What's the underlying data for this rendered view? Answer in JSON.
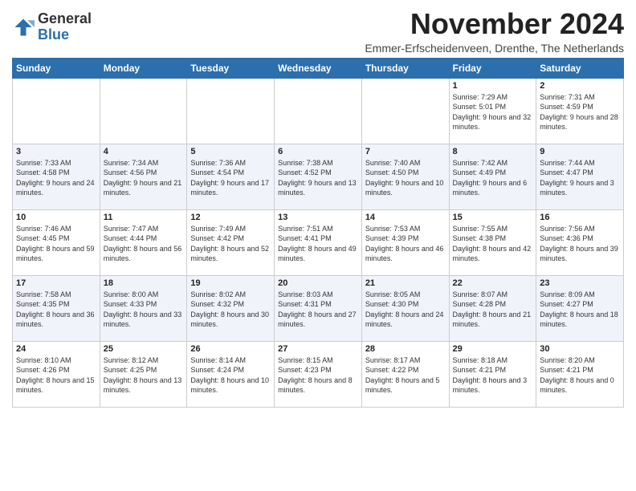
{
  "logo": {
    "general": "General",
    "blue": "Blue"
  },
  "title": "November 2024",
  "subtitle": "Emmer-Erfscheidenveen, Drenthe, The Netherlands",
  "days_of_week": [
    "Sunday",
    "Monday",
    "Tuesday",
    "Wednesday",
    "Thursday",
    "Friday",
    "Saturday"
  ],
  "weeks": [
    [
      {
        "day": "",
        "sunrise": "",
        "sunset": "",
        "daylight": ""
      },
      {
        "day": "",
        "sunrise": "",
        "sunset": "",
        "daylight": ""
      },
      {
        "day": "",
        "sunrise": "",
        "sunset": "",
        "daylight": ""
      },
      {
        "day": "",
        "sunrise": "",
        "sunset": "",
        "daylight": ""
      },
      {
        "day": "",
        "sunrise": "",
        "sunset": "",
        "daylight": ""
      },
      {
        "day": "1",
        "sunrise": "Sunrise: 7:29 AM",
        "sunset": "Sunset: 5:01 PM",
        "daylight": "Daylight: 9 hours and 32 minutes."
      },
      {
        "day": "2",
        "sunrise": "Sunrise: 7:31 AM",
        "sunset": "Sunset: 4:59 PM",
        "daylight": "Daylight: 9 hours and 28 minutes."
      }
    ],
    [
      {
        "day": "3",
        "sunrise": "Sunrise: 7:33 AM",
        "sunset": "Sunset: 4:58 PM",
        "daylight": "Daylight: 9 hours and 24 minutes."
      },
      {
        "day": "4",
        "sunrise": "Sunrise: 7:34 AM",
        "sunset": "Sunset: 4:56 PM",
        "daylight": "Daylight: 9 hours and 21 minutes."
      },
      {
        "day": "5",
        "sunrise": "Sunrise: 7:36 AM",
        "sunset": "Sunset: 4:54 PM",
        "daylight": "Daylight: 9 hours and 17 minutes."
      },
      {
        "day": "6",
        "sunrise": "Sunrise: 7:38 AM",
        "sunset": "Sunset: 4:52 PM",
        "daylight": "Daylight: 9 hours and 13 minutes."
      },
      {
        "day": "7",
        "sunrise": "Sunrise: 7:40 AM",
        "sunset": "Sunset: 4:50 PM",
        "daylight": "Daylight: 9 hours and 10 minutes."
      },
      {
        "day": "8",
        "sunrise": "Sunrise: 7:42 AM",
        "sunset": "Sunset: 4:49 PM",
        "daylight": "Daylight: 9 hours and 6 minutes."
      },
      {
        "day": "9",
        "sunrise": "Sunrise: 7:44 AM",
        "sunset": "Sunset: 4:47 PM",
        "daylight": "Daylight: 9 hours and 3 minutes."
      }
    ],
    [
      {
        "day": "10",
        "sunrise": "Sunrise: 7:46 AM",
        "sunset": "Sunset: 4:45 PM",
        "daylight": "Daylight: 8 hours and 59 minutes."
      },
      {
        "day": "11",
        "sunrise": "Sunrise: 7:47 AM",
        "sunset": "Sunset: 4:44 PM",
        "daylight": "Daylight: 8 hours and 56 minutes."
      },
      {
        "day": "12",
        "sunrise": "Sunrise: 7:49 AM",
        "sunset": "Sunset: 4:42 PM",
        "daylight": "Daylight: 8 hours and 52 minutes."
      },
      {
        "day": "13",
        "sunrise": "Sunrise: 7:51 AM",
        "sunset": "Sunset: 4:41 PM",
        "daylight": "Daylight: 8 hours and 49 minutes."
      },
      {
        "day": "14",
        "sunrise": "Sunrise: 7:53 AM",
        "sunset": "Sunset: 4:39 PM",
        "daylight": "Daylight: 8 hours and 46 minutes."
      },
      {
        "day": "15",
        "sunrise": "Sunrise: 7:55 AM",
        "sunset": "Sunset: 4:38 PM",
        "daylight": "Daylight: 8 hours and 42 minutes."
      },
      {
        "day": "16",
        "sunrise": "Sunrise: 7:56 AM",
        "sunset": "Sunset: 4:36 PM",
        "daylight": "Daylight: 8 hours and 39 minutes."
      }
    ],
    [
      {
        "day": "17",
        "sunrise": "Sunrise: 7:58 AM",
        "sunset": "Sunset: 4:35 PM",
        "daylight": "Daylight: 8 hours and 36 minutes."
      },
      {
        "day": "18",
        "sunrise": "Sunrise: 8:00 AM",
        "sunset": "Sunset: 4:33 PM",
        "daylight": "Daylight: 8 hours and 33 minutes."
      },
      {
        "day": "19",
        "sunrise": "Sunrise: 8:02 AM",
        "sunset": "Sunset: 4:32 PM",
        "daylight": "Daylight: 8 hours and 30 minutes."
      },
      {
        "day": "20",
        "sunrise": "Sunrise: 8:03 AM",
        "sunset": "Sunset: 4:31 PM",
        "daylight": "Daylight: 8 hours and 27 minutes."
      },
      {
        "day": "21",
        "sunrise": "Sunrise: 8:05 AM",
        "sunset": "Sunset: 4:30 PM",
        "daylight": "Daylight: 8 hours and 24 minutes."
      },
      {
        "day": "22",
        "sunrise": "Sunrise: 8:07 AM",
        "sunset": "Sunset: 4:28 PM",
        "daylight": "Daylight: 8 hours and 21 minutes."
      },
      {
        "day": "23",
        "sunrise": "Sunrise: 8:09 AM",
        "sunset": "Sunset: 4:27 PM",
        "daylight": "Daylight: 8 hours and 18 minutes."
      }
    ],
    [
      {
        "day": "24",
        "sunrise": "Sunrise: 8:10 AM",
        "sunset": "Sunset: 4:26 PM",
        "daylight": "Daylight: 8 hours and 15 minutes."
      },
      {
        "day": "25",
        "sunrise": "Sunrise: 8:12 AM",
        "sunset": "Sunset: 4:25 PM",
        "daylight": "Daylight: 8 hours and 13 minutes."
      },
      {
        "day": "26",
        "sunrise": "Sunrise: 8:14 AM",
        "sunset": "Sunset: 4:24 PM",
        "daylight": "Daylight: 8 hours and 10 minutes."
      },
      {
        "day": "27",
        "sunrise": "Sunrise: 8:15 AM",
        "sunset": "Sunset: 4:23 PM",
        "daylight": "Daylight: 8 hours and 8 minutes."
      },
      {
        "day": "28",
        "sunrise": "Sunrise: 8:17 AM",
        "sunset": "Sunset: 4:22 PM",
        "daylight": "Daylight: 8 hours and 5 minutes."
      },
      {
        "day": "29",
        "sunrise": "Sunrise: 8:18 AM",
        "sunset": "Sunset: 4:21 PM",
        "daylight": "Daylight: 8 hours and 3 minutes."
      },
      {
        "day": "30",
        "sunrise": "Sunrise: 8:20 AM",
        "sunset": "Sunset: 4:21 PM",
        "daylight": "Daylight: 8 hours and 0 minutes."
      }
    ]
  ]
}
